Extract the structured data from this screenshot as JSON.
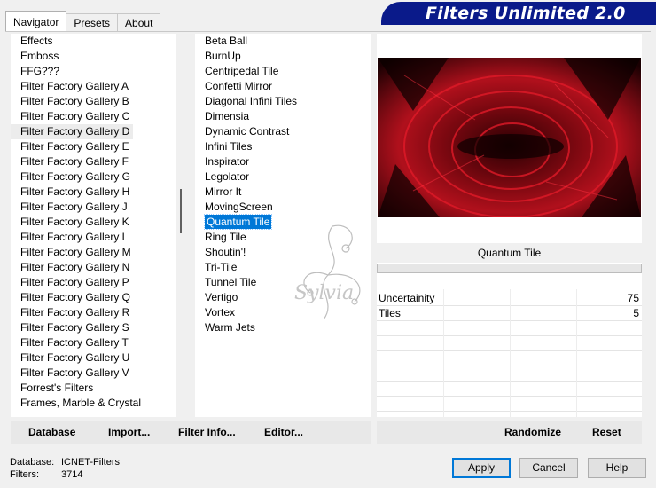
{
  "tabs": [
    {
      "label": "Navigator",
      "active": true
    },
    {
      "label": "Presets",
      "active": false
    },
    {
      "label": "About",
      "active": false
    }
  ],
  "banner": {
    "title": "Filters Unlimited 2.0"
  },
  "categories": {
    "items": [
      "Effects",
      "Emboss",
      "FFG???",
      "Filter Factory Gallery A",
      "Filter Factory Gallery B",
      "Filter Factory Gallery C",
      "Filter Factory Gallery D",
      "Filter Factory Gallery E",
      "Filter Factory Gallery F",
      "Filter Factory Gallery G",
      "Filter Factory Gallery H",
      "Filter Factory Gallery J",
      "Filter Factory Gallery K",
      "Filter Factory Gallery L",
      "Filter Factory Gallery M",
      "Filter Factory Gallery N",
      "Filter Factory Gallery P",
      "Filter Factory Gallery Q",
      "Filter Factory Gallery R",
      "Filter Factory Gallery S",
      "Filter Factory Gallery T",
      "Filter Factory Gallery U",
      "Filter Factory Gallery V",
      "Forrest's Filters",
      "Frames, Marble & Crystal"
    ],
    "highlighted": "Filter Factory Gallery D"
  },
  "filters": {
    "items": [
      "Beta Ball",
      "BurnUp",
      "Centripedal Tile",
      "Confetti Mirror",
      "Diagonal Infini Tiles",
      "Dimensia",
      "Dynamic Contrast",
      "Infini Tiles",
      "Inspirator",
      "Legolator",
      "Mirror It",
      "MovingScreen",
      "Quantum Tile",
      "Ring Tile",
      "Shoutin'!",
      "Tri-Tile",
      "Tunnel Tile",
      "Vertigo",
      "Vortex",
      "Warm Jets"
    ],
    "selected": "Quantum Tile"
  },
  "preview": {
    "filter_name": "Quantum Tile"
  },
  "params": [
    {
      "name": "Uncertainity",
      "value": "75"
    },
    {
      "name": "Tiles",
      "value": "5"
    }
  ],
  "left_buttons": {
    "database": "Database",
    "import": "Import...",
    "filter_info": "Filter Info...",
    "editor": "Editor..."
  },
  "right_buttons": {
    "randomize": "Randomize",
    "reset": "Reset"
  },
  "status": {
    "db_label": "Database:",
    "db_value": "ICNET-Filters",
    "filters_label": "Filters:",
    "filters_value": "3714"
  },
  "dialog_buttons": {
    "apply": "Apply",
    "cancel": "Cancel",
    "help": "Help"
  },
  "watermark_text": "Sylvia",
  "colors": {
    "banner": "#0a1a8a",
    "selection": "#0078d7",
    "preview_dark": "#120000",
    "preview_red": "#b0101c"
  }
}
